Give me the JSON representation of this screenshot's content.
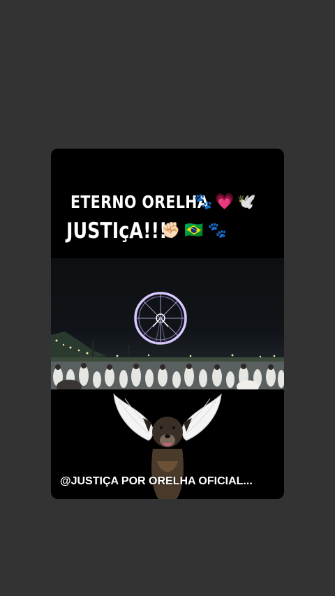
{
  "story": {
    "line1": "ETERNO ORELHA",
    "line2": "JUSTIçA!!!!",
    "line1_emojis": [
      "🐾",
      "💗",
      "🕊️"
    ],
    "line2_emojis": [
      "✊🏻",
      "🇧🇷",
      "🐾"
    ],
    "caption": "@JUSTIÇA  POR ORELHA OFICIAL..."
  },
  "colors": {
    "background": "#333333",
    "card": "#000000",
    "text": "#ffffff",
    "ferris_wheel": "#d9c8ff"
  },
  "icons": {
    "paw": "paw-prints-icon",
    "heart": "pink-heart-icon",
    "dove": "dove-icon",
    "fist": "raised-fist-icon",
    "flag": "brazil-flag-icon"
  }
}
